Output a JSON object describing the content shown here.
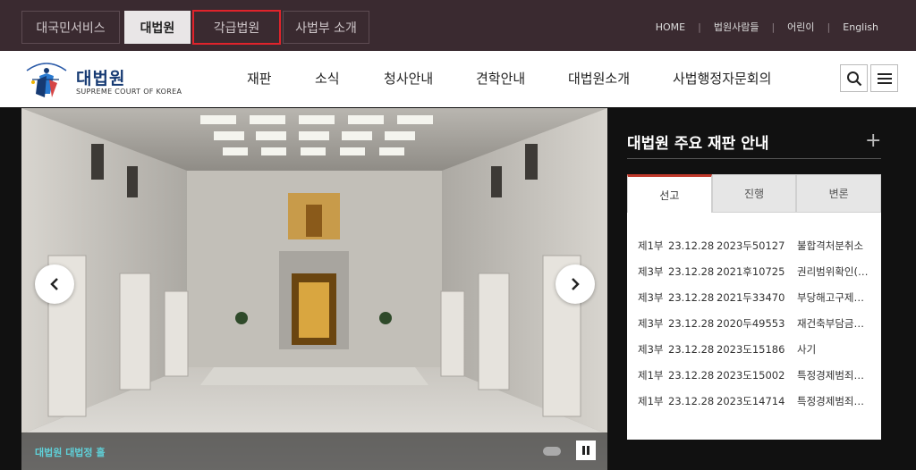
{
  "top_tabs": [
    "대국민서비스",
    "대법원",
    "각급법원",
    "사법부 소개"
  ],
  "util_links": [
    "HOME",
    "법원사람들",
    "어린이",
    "English"
  ],
  "logo": {
    "title": "대법원",
    "subtitle": "SUPREME COURT OF KOREA"
  },
  "main_menu": [
    "재판",
    "소식",
    "청사안내",
    "견학안내",
    "대법원소개",
    "사법행정자문회의"
  ],
  "hero": {
    "caption": "대법원 대법정 홀"
  },
  "panel": {
    "title": "대법원 주요 재판 안내",
    "tabs": [
      "선고",
      "진행",
      "변론"
    ],
    "rows": [
      {
        "dept": "제1부",
        "date": "23.12.28",
        "case": "2023두50127",
        "name": "불합격처분취소"
      },
      {
        "dept": "제3부",
        "date": "23.12.28",
        "case": "2021후10725",
        "name": "권리범위확인(…"
      },
      {
        "dept": "제3부",
        "date": "23.12.28",
        "case": "2021두33470",
        "name": "부당해고구제…"
      },
      {
        "dept": "제3부",
        "date": "23.12.28",
        "case": "2020두49553",
        "name": "재건축부담금…"
      },
      {
        "dept": "제3부",
        "date": "23.12.28",
        "case": "2023도15186",
        "name": "사기"
      },
      {
        "dept": "제1부",
        "date": "23.12.28",
        "case": "2023도15002",
        "name": "특정경제범죄…"
      },
      {
        "dept": "제1부",
        "date": "23.12.28",
        "case": "2023도14714",
        "name": "특정경제범죄…"
      }
    ]
  },
  "colors": {
    "topbar": "#3a2a30",
    "highlight": "#e0232b",
    "caption": "#5fd0d8",
    "tab_active_border": "#c0392b"
  },
  "icons": [
    "search-icon",
    "hamburger-menu-icon",
    "chevron-left-icon",
    "chevron-right-icon",
    "pause-icon",
    "plus-icon",
    "logo-emblem"
  ]
}
